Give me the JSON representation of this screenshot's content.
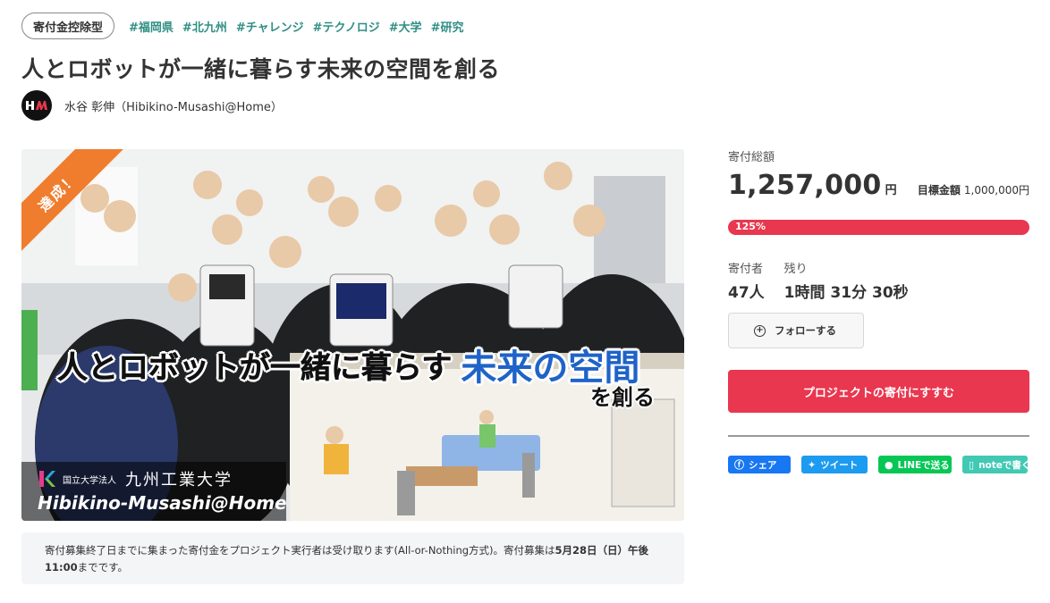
{
  "header": {
    "category": "寄付金控除型",
    "tags": [
      "#福岡県",
      "#北九州",
      "#チャレンジ",
      "#テクノロジ",
      "#大学",
      "#研究"
    ],
    "title": "人とロボットが一緒に暮らす未来の空間を創る",
    "author": "水谷 彰伸（Hibikino-Musashi@Home）"
  },
  "hero": {
    "ribbon": "達成！",
    "headline_part1": "人とロボットが一緒に暮らす",
    "headline_part2": "未来の空間",
    "headline_part3": "を創る",
    "uni_corp": "国立大学法人",
    "uni_name": "九州工業大学",
    "uni_team": "Hibikino-Musashi@Home"
  },
  "notice": {
    "text_before": "寄付募集終了日までに集まった寄付金をプロジェクト実行者は受け取ります(All-or-Nothing方式)。寄付募集は",
    "deadline": "5月28日（日）午後11:00",
    "text_after": "までです。"
  },
  "side": {
    "total_label": "寄付総額",
    "total_amount": "1,257,000",
    "total_unit": "円",
    "goal_label": "目標金額",
    "goal_amount": "1,000,000円",
    "progress_label": "125%",
    "progress_percent": 125,
    "donors_label": "寄付者",
    "donors_value": "47人",
    "remaining_label": "残り",
    "remaining_value": "1時間 31分 30秒",
    "follow_label": "フォローする",
    "cta_label": "プロジェクトの寄付にすすむ",
    "share": {
      "facebook": "シェア",
      "twitter": "ツイート",
      "line": "LINEで送る",
      "note": "noteで書く"
    }
  },
  "colors": {
    "accent": "#e8374f",
    "tag": "#2f8f84",
    "ribbon": "#ef7d2d",
    "headline_blue": "#1f63c8"
  }
}
